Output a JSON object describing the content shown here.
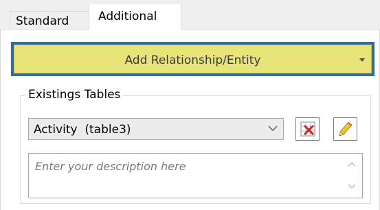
{
  "tabs": [
    {
      "label": "Standard",
      "active": false
    },
    {
      "label": "Additional",
      "active": true
    }
  ],
  "add_relationship": {
    "label": "Add Relationship/Entity",
    "background_color": "#e8e47a",
    "focus_border_color": "#2e6da4",
    "icon": "dropdown-arrow-icon"
  },
  "existing_tables": {
    "title": "Existings Tables",
    "selected_value": "Activity  (table3)",
    "delete_icon": "delete-table-icon",
    "edit_icon": "edit-pencil-icon"
  },
  "description": {
    "placeholder": "Enter your description here",
    "value": ""
  }
}
